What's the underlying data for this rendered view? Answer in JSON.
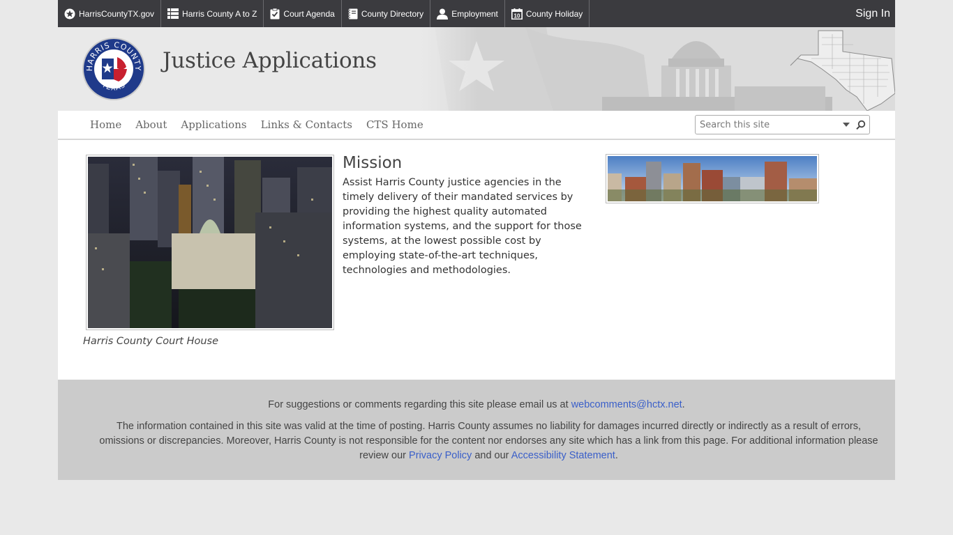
{
  "topbar": {
    "links": [
      {
        "label": "HarrisCountyTX.gov",
        "icon": "star-circle-icon"
      },
      {
        "label": "Harris County A to Z",
        "icon": "list-icon"
      },
      {
        "label": "Court Agenda",
        "icon": "clipboard-check-icon"
      },
      {
        "label": "County Directory",
        "icon": "book-icon"
      },
      {
        "label": "Employment",
        "icon": "person-icon"
      },
      {
        "label": "County Holiday",
        "icon": "calendar-icon"
      }
    ],
    "signin": "Sign In"
  },
  "banner": {
    "title": "Justice Applications",
    "seal_text_top": "HARRIS COUNTY",
    "seal_text_bottom": "TEXAS"
  },
  "nav": {
    "items": [
      "Home",
      "About",
      "Applications",
      "Links & Contacts",
      "CTS Home"
    ],
    "search_placeholder": "Search this site"
  },
  "content": {
    "caption": "Harris County Court House",
    "mission_heading": "Mission",
    "mission_text": "Assist Harris County justice agencies in the timely delivery of their mandated services by providing the highest quality automated information systems, and the support for those systems, at the lowest possible cost by employing state-of-the-art techniques, technologies and methodologies."
  },
  "footer": {
    "line1_prefix": "For suggestions or comments regarding this site please email us at ",
    "email": "webcomments@hctx.net",
    "line1_suffix": ".",
    "line2_text": "The information contained in this site was valid at the time of posting. Harris County assumes no liability for damages incurred directly or indirectly as a result of errors, omissions or discrepancies. Moreover, Harris County is not responsible for the content nor endorses any site which has a link from this page. For additional information please review our ",
    "privacy_link": "Privacy Policy",
    "and_our": " and our ",
    "accessibility_link": "Accessibility Statement",
    "line2_end": "."
  },
  "colors": {
    "topbar_bg": "#3b3b3f",
    "page_bg": "#e9e9e9",
    "footer_bg": "#cbcbcb",
    "link_blue": "#3a5fc9",
    "seal_blue": "#1f3a8a",
    "seal_red": "#c8202f"
  }
}
